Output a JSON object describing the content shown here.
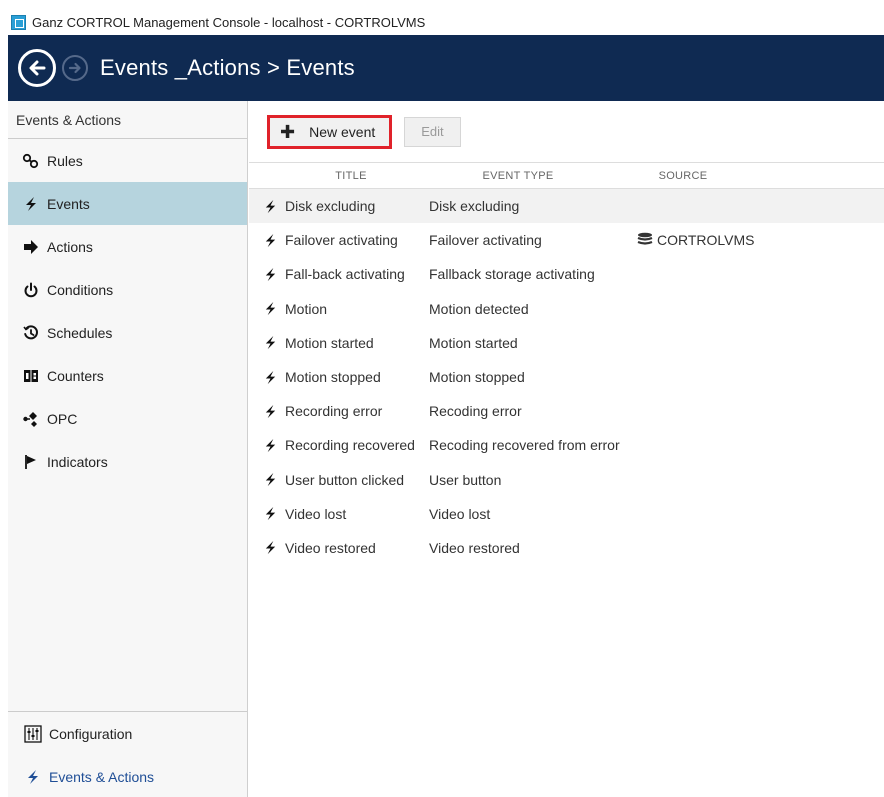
{
  "window": {
    "title": "Ganz CORTROL Management Console - localhost - CORTROLVMS"
  },
  "header": {
    "title": "Events _Actions > Events",
    "back_icon": "arrow-left-icon",
    "forward_icon": "arrow-right-icon"
  },
  "sidebar": {
    "section_title": "Events & Actions",
    "items": [
      {
        "label": "Rules",
        "icon": "rules-icon"
      },
      {
        "label": "Events",
        "icon": "bolt-icon"
      },
      {
        "label": "Actions",
        "icon": "action-arrow-icon"
      },
      {
        "label": "Conditions",
        "icon": "power-icon"
      },
      {
        "label": "Schedules",
        "icon": "clock-icon"
      },
      {
        "label": "Counters",
        "icon": "counter-icon"
      },
      {
        "label": "OPC",
        "icon": "opc-icon"
      },
      {
        "label": "Indicators",
        "icon": "flag-icon"
      }
    ],
    "active_item": "Events",
    "bottom": [
      {
        "label": "Configuration",
        "icon": "configuration-icon"
      },
      {
        "label": "Events & Actions",
        "icon": "bolt-icon"
      }
    ]
  },
  "toolbar": {
    "new_label": "New event",
    "edit_label": "Edit"
  },
  "table": {
    "columns": [
      "TITLE",
      "EVENT TYPE",
      "SOURCE"
    ],
    "rows": [
      {
        "title": "Disk excluding",
        "type": "Disk excluding",
        "source": ""
      },
      {
        "title": "Failover activating",
        "type": "Failover activating",
        "source": "CORTROLVMS"
      },
      {
        "title": "Fall-back activating",
        "type": "Fallback storage activating",
        "source": ""
      },
      {
        "title": "Motion",
        "type": "Motion detected",
        "source": ""
      },
      {
        "title": "Motion started",
        "type": "Motion started",
        "source": ""
      },
      {
        "title": "Motion stopped",
        "type": "Motion stopped",
        "source": ""
      },
      {
        "title": "Recording error",
        "type": "Recoding error",
        "source": ""
      },
      {
        "title": "Recording recovered",
        "type": "Recoding recovered from error",
        "source": ""
      },
      {
        "title": "User button clicked",
        "type": "User button",
        "source": ""
      },
      {
        "title": "Video lost",
        "type": "Video lost",
        "source": ""
      },
      {
        "title": "Video restored",
        "type": "Video restored",
        "source": ""
      }
    ]
  },
  "colors": {
    "header_bg": "#0f2a52",
    "active_item_bg": "#b6d4de",
    "highlight_border": "#e0222a",
    "accent": "#1f4e96"
  }
}
